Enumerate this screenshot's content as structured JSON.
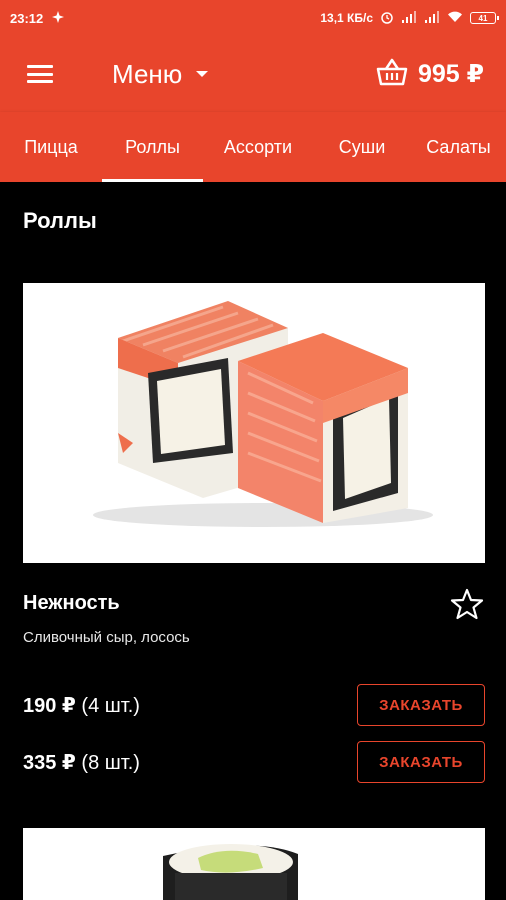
{
  "status_bar": {
    "time": "23:12",
    "network_speed": "13,1 КБ/с",
    "battery": "41"
  },
  "app_bar": {
    "title": "Меню",
    "cart_total": "995 ₽"
  },
  "tabs": [
    {
      "label": "Пицца",
      "active": false
    },
    {
      "label": "Роллы",
      "active": true
    },
    {
      "label": "Ассорти",
      "active": false
    },
    {
      "label": "Суши",
      "active": false
    },
    {
      "label": "Салаты",
      "active": false
    }
  ],
  "section": {
    "title": "Роллы"
  },
  "product": {
    "name": "Нежность",
    "description": "Сливочный сыр, лосось",
    "options": [
      {
        "price": "190 ₽",
        "qty": "(4 шт.)",
        "button": "ЗАКАЗАТЬ"
      },
      {
        "price": "335 ₽",
        "qty": "(8 шт.)",
        "button": "ЗАКАЗАТЬ"
      }
    ]
  },
  "colors": {
    "accent": "#e8452c",
    "background": "#000000"
  }
}
